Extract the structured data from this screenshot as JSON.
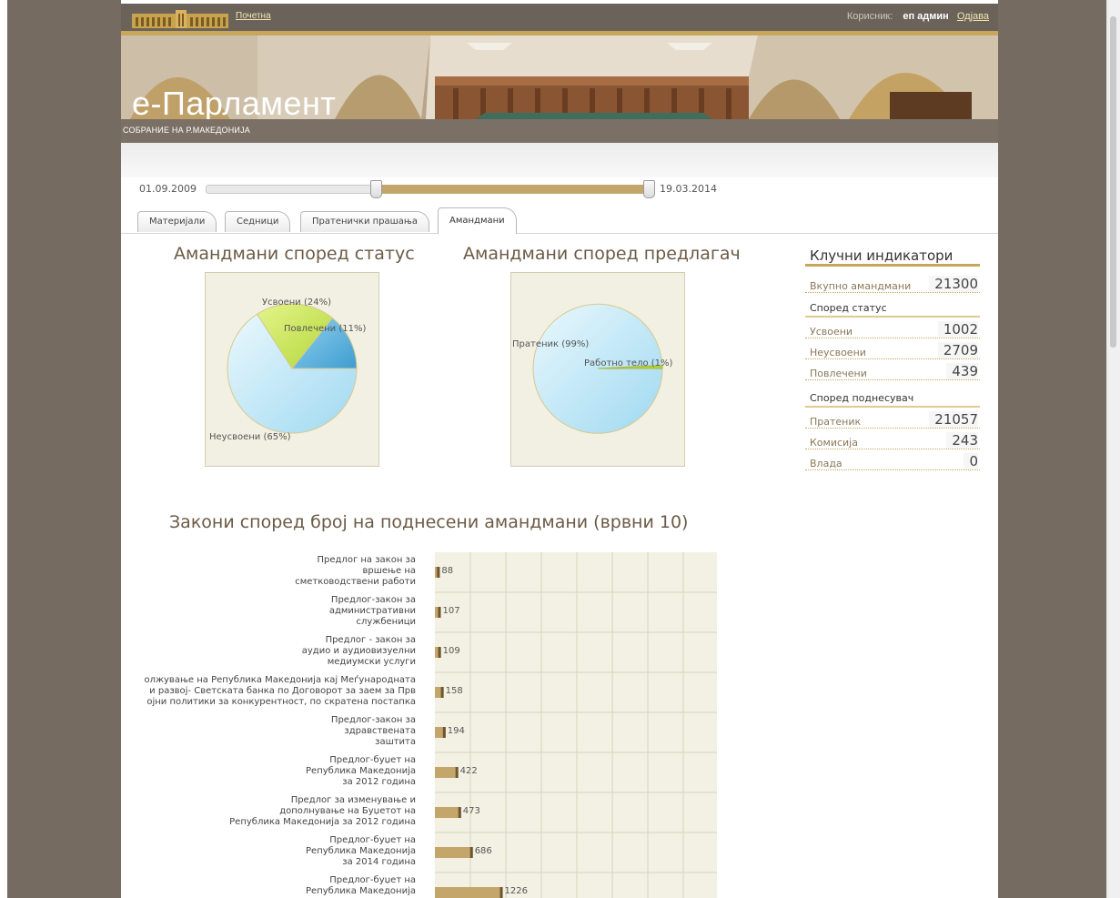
{
  "header": {
    "home_link": "Почетна",
    "user_label": "Корисник:",
    "user_name": "еп админ",
    "logout_link": "Одјава"
  },
  "banner": {
    "title": "е-Парламент",
    "subtitle": "СОБРАНИЕ НА Р.МАКЕДОНИЈА"
  },
  "date_range": {
    "from": "01.09.2009",
    "to": "19.03.2014"
  },
  "tabs": [
    {
      "label": "Материјали"
    },
    {
      "label": "Седници"
    },
    {
      "label": "Пратенички прашања"
    },
    {
      "label": "Амандмани",
      "active": true
    }
  ],
  "status_chart": {
    "title": "Амандмани според статус",
    "labels": [
      "Усвоени (24%)",
      "Повлечени (11%)",
      "Неусвоени (65%)"
    ]
  },
  "proposer_chart": {
    "title": "Амандмани според предлагач",
    "labels": [
      "Пратеник (99%)",
      "Работно тело (1%)"
    ]
  },
  "indicators": {
    "title": "Клучни индикатори",
    "total_label": "Вкупно амандмани",
    "total_value": "21300",
    "by_status_title": "Според статус",
    "by_status": [
      {
        "label": "Усвоени",
        "value": "1002"
      },
      {
        "label": "Неусвоени",
        "value": "2709"
      },
      {
        "label": "Повлечени",
        "value": "439"
      }
    ],
    "by_submitter_title": "Според поднесувач",
    "by_submitter": [
      {
        "label": "Пратеник",
        "value": "21057"
      },
      {
        "label": "Комисија",
        "value": "243"
      },
      {
        "label": "Влада",
        "value": "0"
      }
    ]
  },
  "laws_chart": {
    "title": "Закони според број на поднесени амандмани (врвни 10)",
    "items": [
      {
        "label": "Предлог на закон за\nвршење на\nсметководствени работи",
        "value": "88"
      },
      {
        "label": "Предлог-закон за\nадминистративни\nслужбеници",
        "value": "107"
      },
      {
        "label": "Предлог - закон за\nаудио и аудиовизуелни\nмедиумски услуги",
        "value": "109"
      },
      {
        "label": "олжување на Република Македонија кај Меѓународната\nи развој- Светската банка по Договорот за заем за Прв\nојни политики за конкурентност, по скратена постапка",
        "value": "158"
      },
      {
        "label": "Предлог-закон за\nздравствената\nзаштита",
        "value": "194"
      },
      {
        "label": "Предлог-буџет на\nРепублика Македонија\nза 2012 година",
        "value": "422"
      },
      {
        "label": "Предлог за изменување и\nдополнување на Буџетот на\nРепублика Македонија за 2012 година",
        "value": "473"
      },
      {
        "label": "Предлог-буџет на\nРепублика Македонија\nза 2014 година",
        "value": "686"
      },
      {
        "label": "Предлог-буџет на\nРепублика Македонија",
        "value": "1226"
      }
    ]
  },
  "chart_data": [
    {
      "type": "pie",
      "title": "Амандмани според статус",
      "labels": [
        "Усвоени",
        "Повлечени",
        "Неусвоени"
      ],
      "values": [
        24,
        11,
        65
      ],
      "colors": [
        "#c3e04a",
        "#4aa6d6",
        "#bfe7f7"
      ]
    },
    {
      "type": "pie",
      "title": "Амандмани според предлагач",
      "labels": [
        "Пратеник",
        "Работно тело"
      ],
      "values": [
        99,
        1
      ],
      "colors": [
        "#bfe7f7",
        "#b5d13c"
      ]
    },
    {
      "type": "bar",
      "title": "Закони според број на поднесени амандмани (врвни 10)",
      "values": [
        88,
        107,
        109,
        158,
        194,
        422,
        473,
        686,
        1226
      ],
      "color": "#c4a66b"
    }
  ]
}
